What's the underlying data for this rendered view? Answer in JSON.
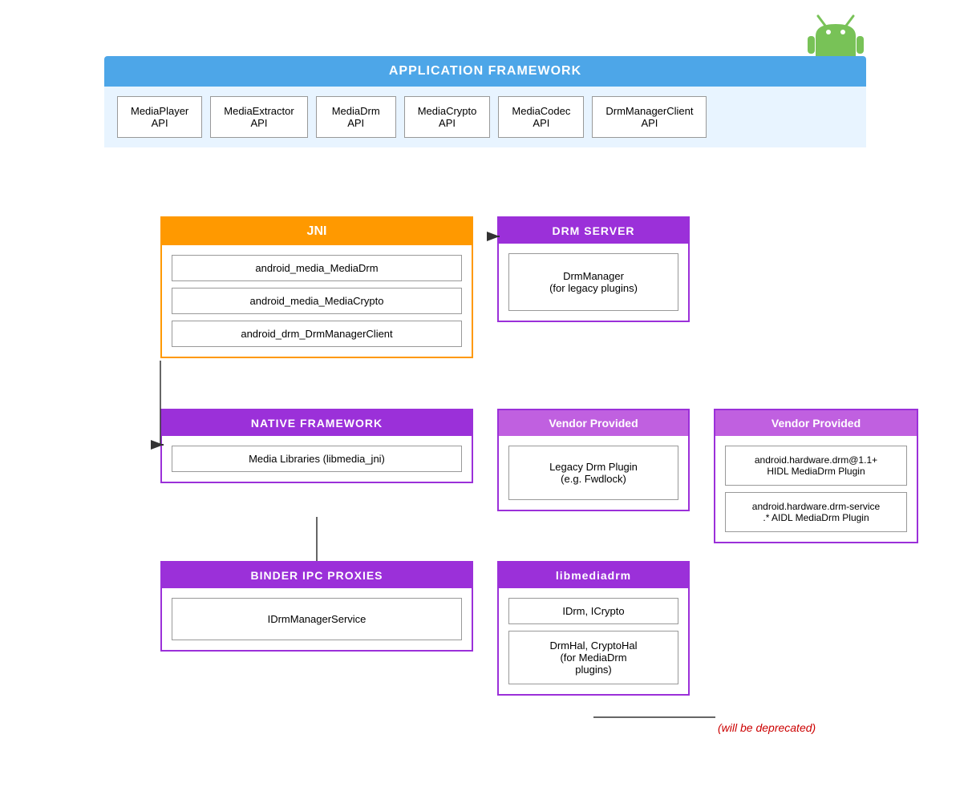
{
  "android_logo": {
    "color_body": "#78C257",
    "color_antenna": "#78C257",
    "color_eye": "#ffffff"
  },
  "app_framework": {
    "title": "APPLICATION FRAMEWORK",
    "apis": [
      {
        "label": "MediaPlayer\nAPI"
      },
      {
        "label": "MediaExtractor\nAPI"
      },
      {
        "label": "MediaDrm\nAPI"
      },
      {
        "label": "MediaCrypto\nAPI"
      },
      {
        "label": "MediaCodec\nAPI"
      },
      {
        "label": "DrmManagerClient\nAPI"
      }
    ]
  },
  "jni_box": {
    "title": "JNI",
    "items": [
      "android_media_MediaDrm",
      "android_media_MediaCrypto",
      "android_drm_DrmManagerClient"
    ]
  },
  "drm_server_box": {
    "title": "DRM SERVER",
    "items": [
      "DrmManager\n(for legacy plugins)"
    ]
  },
  "native_framework_box": {
    "title": "NATIVE FRAMEWORK",
    "items": [
      "Media Libraries (libmedia_jni)"
    ]
  },
  "vendor1_box": {
    "title": "Vendor Provided",
    "items": [
      "Legacy Drm Plugin\n(e.g. Fwdlock)"
    ]
  },
  "vendor2_box": {
    "title": "Vendor Provided",
    "items": [
      "android.hardware.drm@1.1+\nHIDL MediaDrm Plugin",
      "android.hardware.drm-service\n.* AIDL MediaDrm Plugin"
    ]
  },
  "binder_box": {
    "title": "BINDER IPC PROXIES",
    "items": [
      "IDrmManagerService"
    ]
  },
  "libmedia_box": {
    "title": "libmediadrm",
    "items": [
      "IDrm, ICrypto",
      "DrmHal, CryptoHal\n(for MediaDrm\nplugins)"
    ]
  },
  "deprecated_text": "(will be deprecated)"
}
